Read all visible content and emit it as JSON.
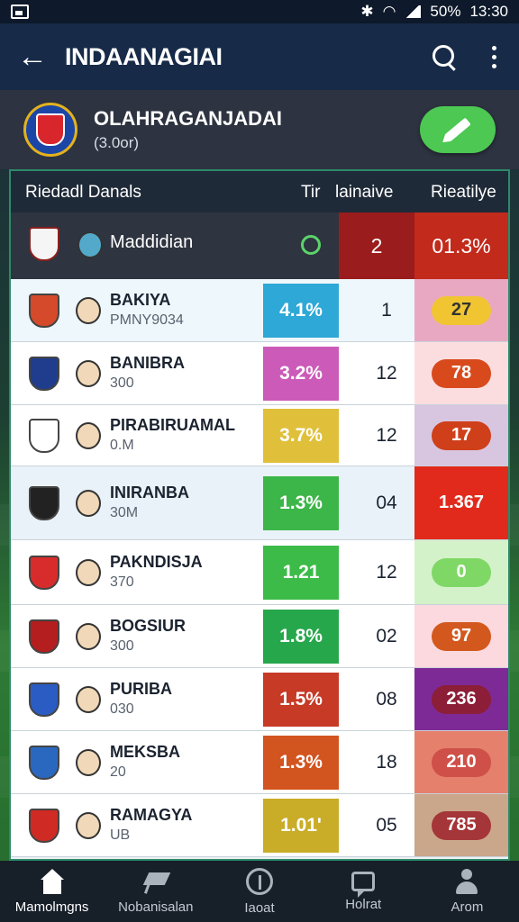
{
  "status_bar": {
    "battery": "50%",
    "time": "13:30"
  },
  "app_bar": {
    "title": "INDAANAGIAI"
  },
  "team": {
    "name": "OLAHRAGANJADAI",
    "sub": "(3.0or)"
  },
  "table": {
    "headers": {
      "name": "Riedadl Danals",
      "col_b": "Tir",
      "col_c": "lainaive",
      "col_d": "Rieatilye"
    },
    "highlight_row": {
      "name": "Maddidian",
      "num": "2",
      "value": "01.3%"
    },
    "rows": [
      {
        "name": "BAKIYA",
        "sub": "PMNY9034",
        "pct": "4.1%",
        "num": "1",
        "pill": "27"
      },
      {
        "name": "BANIBRA",
        "sub": "300",
        "pct": "3.2%",
        "num": "12",
        "pill": "78"
      },
      {
        "name": "PIRABIRUAMAL",
        "sub": "0.M",
        "pct": "3.7%",
        "num": "12",
        "pill": "17"
      },
      {
        "name": "INIRANBA",
        "sub": "30M",
        "pct": "1.3%",
        "num": "04",
        "pill": "1.367"
      },
      {
        "name": "PAKNDISJA",
        "sub": "370",
        "pct": "1.21",
        "num": "12",
        "pill": "0"
      },
      {
        "name": "BOGSIUR",
        "sub": "300",
        "pct": "1.8%",
        "num": "02",
        "pill": "97"
      },
      {
        "name": "PURIBA",
        "sub": "030",
        "pct": "1.5%",
        "num": "08",
        "pill": "236"
      },
      {
        "name": "MEKSBA",
        "sub": "20",
        "pct": "1.3%",
        "num": "18",
        "pill": "210"
      },
      {
        "name": "RAMAGYA",
        "sub": "UB",
        "pct": "1.01'",
        "num": "05",
        "pill": "785"
      }
    ]
  },
  "colors": {
    "pct_badges": [
      "#2ea8d6",
      "#cc5ab8",
      "#e0c03a",
      "#3cb648",
      "#3cbb48",
      "#27a74c",
      "#c63a26",
      "#d2541f",
      "#c9ad28"
    ],
    "row_bg": [
      "#eef7fb",
      "#ffffff",
      "#ffffff",
      "#e9f2f8",
      "#ffffff",
      "#ffffff",
      "#ffffff",
      "#ffffff",
      "#ffffff"
    ],
    "right_bg": [
      "#e9a8c2",
      "#fbdde0",
      "#d8c6e0",
      "#e12a1c",
      "#d3f2c9",
      "#fbd9de",
      "#7e2a96",
      "#e4806c",
      "#caa68a"
    ],
    "pill_bg": [
      "#f1c532",
      "#d84a1c",
      "#cf3f1a",
      "#e12a1c",
      "#7fd866",
      "#d2581e",
      "#8c1e38",
      "#cf5048",
      "#a43538"
    ],
    "pill_text": [
      "#333333",
      "#ffffff",
      "#ffffff",
      "#ffffff",
      "#ffffff",
      "#ffffff",
      "#ffffff",
      "#ffffff",
      "#ffffff"
    ]
  },
  "bottom_nav": [
    {
      "label": "Mamolmgns",
      "icon": "home-icon"
    },
    {
      "label": "Nobanisalan",
      "icon": "flag-icon"
    },
    {
      "label": "Iaoat",
      "icon": "badge-icon"
    },
    {
      "label": "Holrat",
      "icon": "chat-icon"
    },
    {
      "label": "Arom",
      "icon": "person-icon"
    }
  ]
}
